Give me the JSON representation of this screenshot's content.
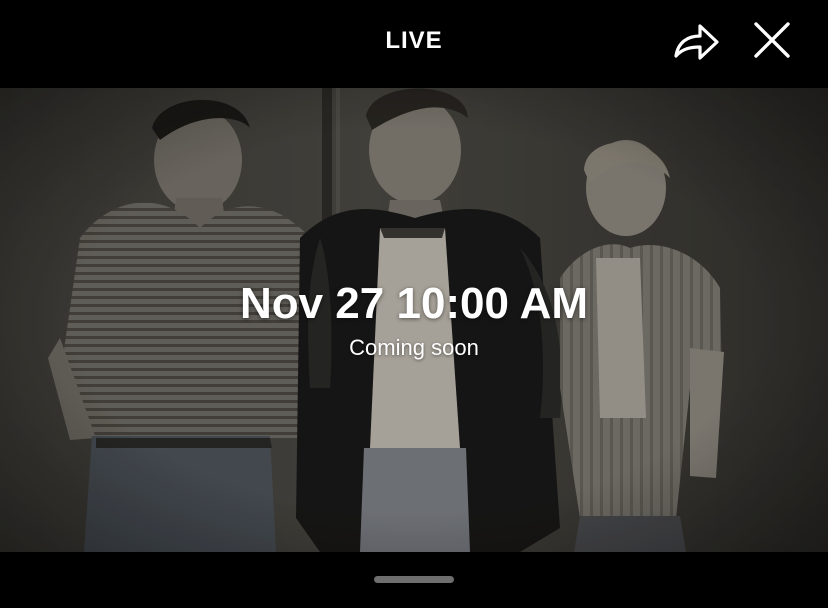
{
  "header": {
    "title": "LIVE",
    "share_icon": "share-arrow-icon",
    "close_icon": "close-icon"
  },
  "event": {
    "time": "Nov 27 10:00 AM",
    "status": "Coming soon"
  },
  "colors": {
    "background": "#000000",
    "text": "#ffffff",
    "photo_tone": "#3a3833",
    "home_indicator": "#6e6e6e"
  }
}
